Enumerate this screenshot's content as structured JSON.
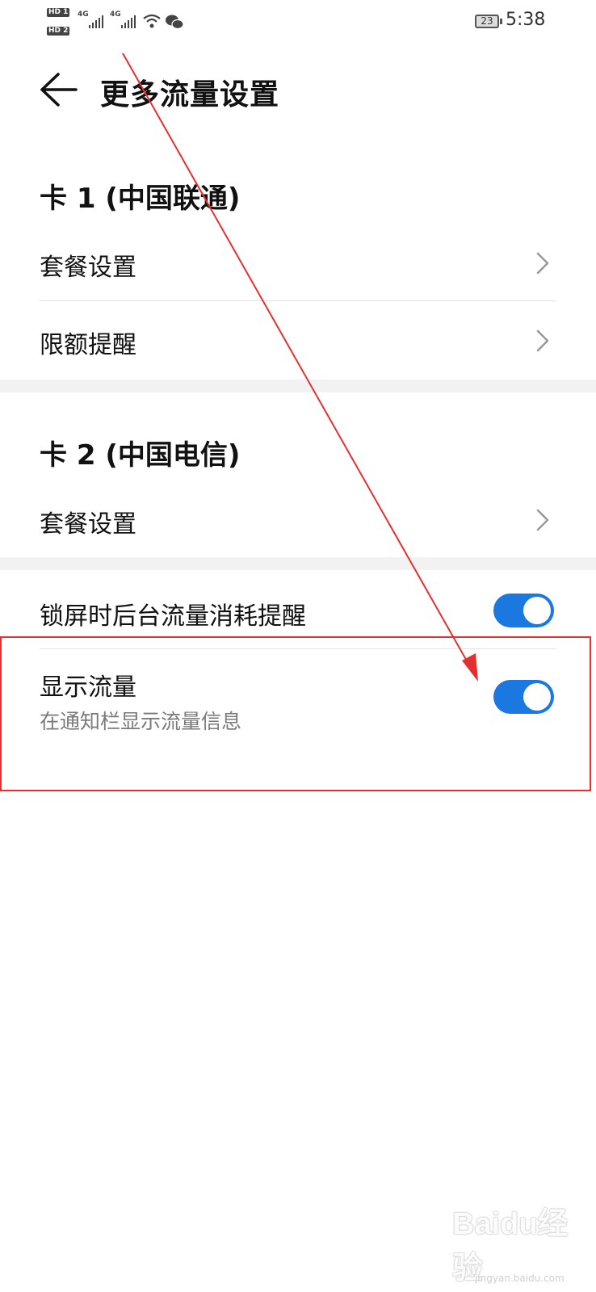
{
  "status_bar": {
    "sim1_badge": "HD 1",
    "sim2_badge": "HD 2",
    "net1": "4G",
    "net2": "4G",
    "battery": "23",
    "time": "5:38",
    "icons": [
      "signal-icon",
      "wifi-icon",
      "wechat-icon",
      "battery-icon"
    ]
  },
  "header": {
    "title": "更多流量设置",
    "back_icon": "arrow-left-icon"
  },
  "sections": {
    "card1": {
      "heading": "卡 1 (中国联通)",
      "items": [
        "套餐设置",
        "限额提醒"
      ]
    },
    "card2": {
      "heading": "卡 2 (中国电信)",
      "items": [
        "套餐设置"
      ]
    },
    "general": {
      "lockscreen_reminder": {
        "label": "锁屏时后台流量消耗提醒",
        "enabled": true
      },
      "show_traffic": {
        "label": "显示流量",
        "description": "在通知栏显示流量信息",
        "enabled": true
      }
    }
  },
  "colors": {
    "toggle_on": "#1a78e0",
    "annotation": "#e53030"
  },
  "watermark": "Baidu经验",
  "watermark_sub": "jingyan.baidu.com"
}
